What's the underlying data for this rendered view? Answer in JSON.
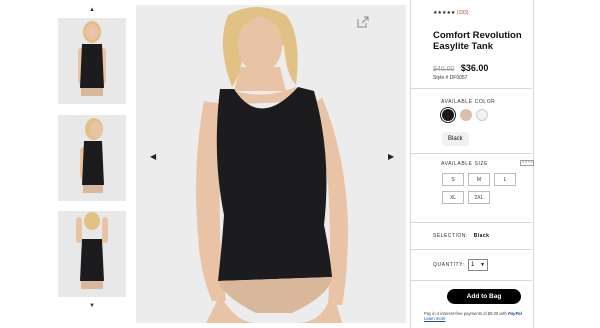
{
  "rating": {
    "stars": "★★★★★",
    "count": "(193)"
  },
  "product": {
    "title_line1": "Comfort Revolution",
    "title_line2": "Easylite Tank",
    "original_price": "$40.00",
    "price": "$36.00",
    "style": "Style # DF0057"
  },
  "color": {
    "label": "AVAILABLE COLOR",
    "swatches": [
      "#1a1a1a",
      "#d8bfa8",
      "#f2f2f2"
    ],
    "selected_name": "Black"
  },
  "size": {
    "label": "AVAILABLE SIZE",
    "options": [
      "S",
      "M",
      "L",
      "XL",
      "2XL"
    ]
  },
  "selection": {
    "label": "SELECTION:",
    "value": "Black"
  },
  "quantity": {
    "label": "QUANTITY:",
    "value": "1"
  },
  "cart": {
    "button_label": "Add to Bag"
  },
  "paypal": {
    "text": "Pay in 4 interest-free payments of $9.00 with",
    "brand": "PayPal",
    "link": "Learn more"
  },
  "colors": {
    "tank": "#1c1c1e",
    "skin": "#e9c3a6",
    "hair": "#e2c284",
    "underwear": "#d9b79a",
    "button": "#000000",
    "paypal_blue": "#1d4fa0"
  }
}
